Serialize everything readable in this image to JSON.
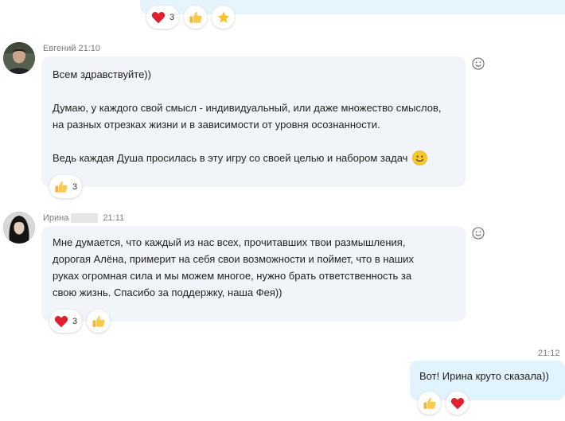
{
  "top_message": {
    "reactions": [
      {
        "icon": "heart-icon",
        "count": "3"
      },
      {
        "icon": "thumbs-up-icon",
        "count": ""
      },
      {
        "icon": "star-icon",
        "count": ""
      }
    ]
  },
  "messages": [
    {
      "author": "Евгений",
      "time": "21:10",
      "paragraphs": [
        "Всем здравствуйте))",
        "Думаю, у каждого свой смысл - индивидуальный, или даже множество смыслов,\nна разных отрезках жизни и в зависимости от уровня осознанности.",
        "Ведь каждая Душа просилась в эту игру со своей целью и набором задач"
      ],
      "reactions": [
        {
          "icon": "thumbs-up-icon",
          "count": "3"
        }
      ]
    },
    {
      "author": "Ирина",
      "time": "21:11",
      "paragraphs": [
        "Мне думается,  что каждый из нас всех,  прочитавших твои размышления,\nдорогая Алёна,  примерит на себя свои возможности и поймет,  что в наших\nруках огромная сила и мы можем многое,  нужно брать ответственность за\nсвою жизнь.  Спасибо за поддержку, наша Фея))"
      ],
      "reactions": [
        {
          "icon": "heart-icon",
          "count": "3"
        },
        {
          "icon": "thumbs-up-icon",
          "count": ""
        }
      ]
    }
  ],
  "outgoing": {
    "time": "21:12",
    "text": "Вот! Ирина круто сказала))",
    "reactions": [
      {
        "icon": "thumbs-up-icon",
        "count": ""
      },
      {
        "icon": "heart-icon",
        "count": ""
      }
    ]
  }
}
